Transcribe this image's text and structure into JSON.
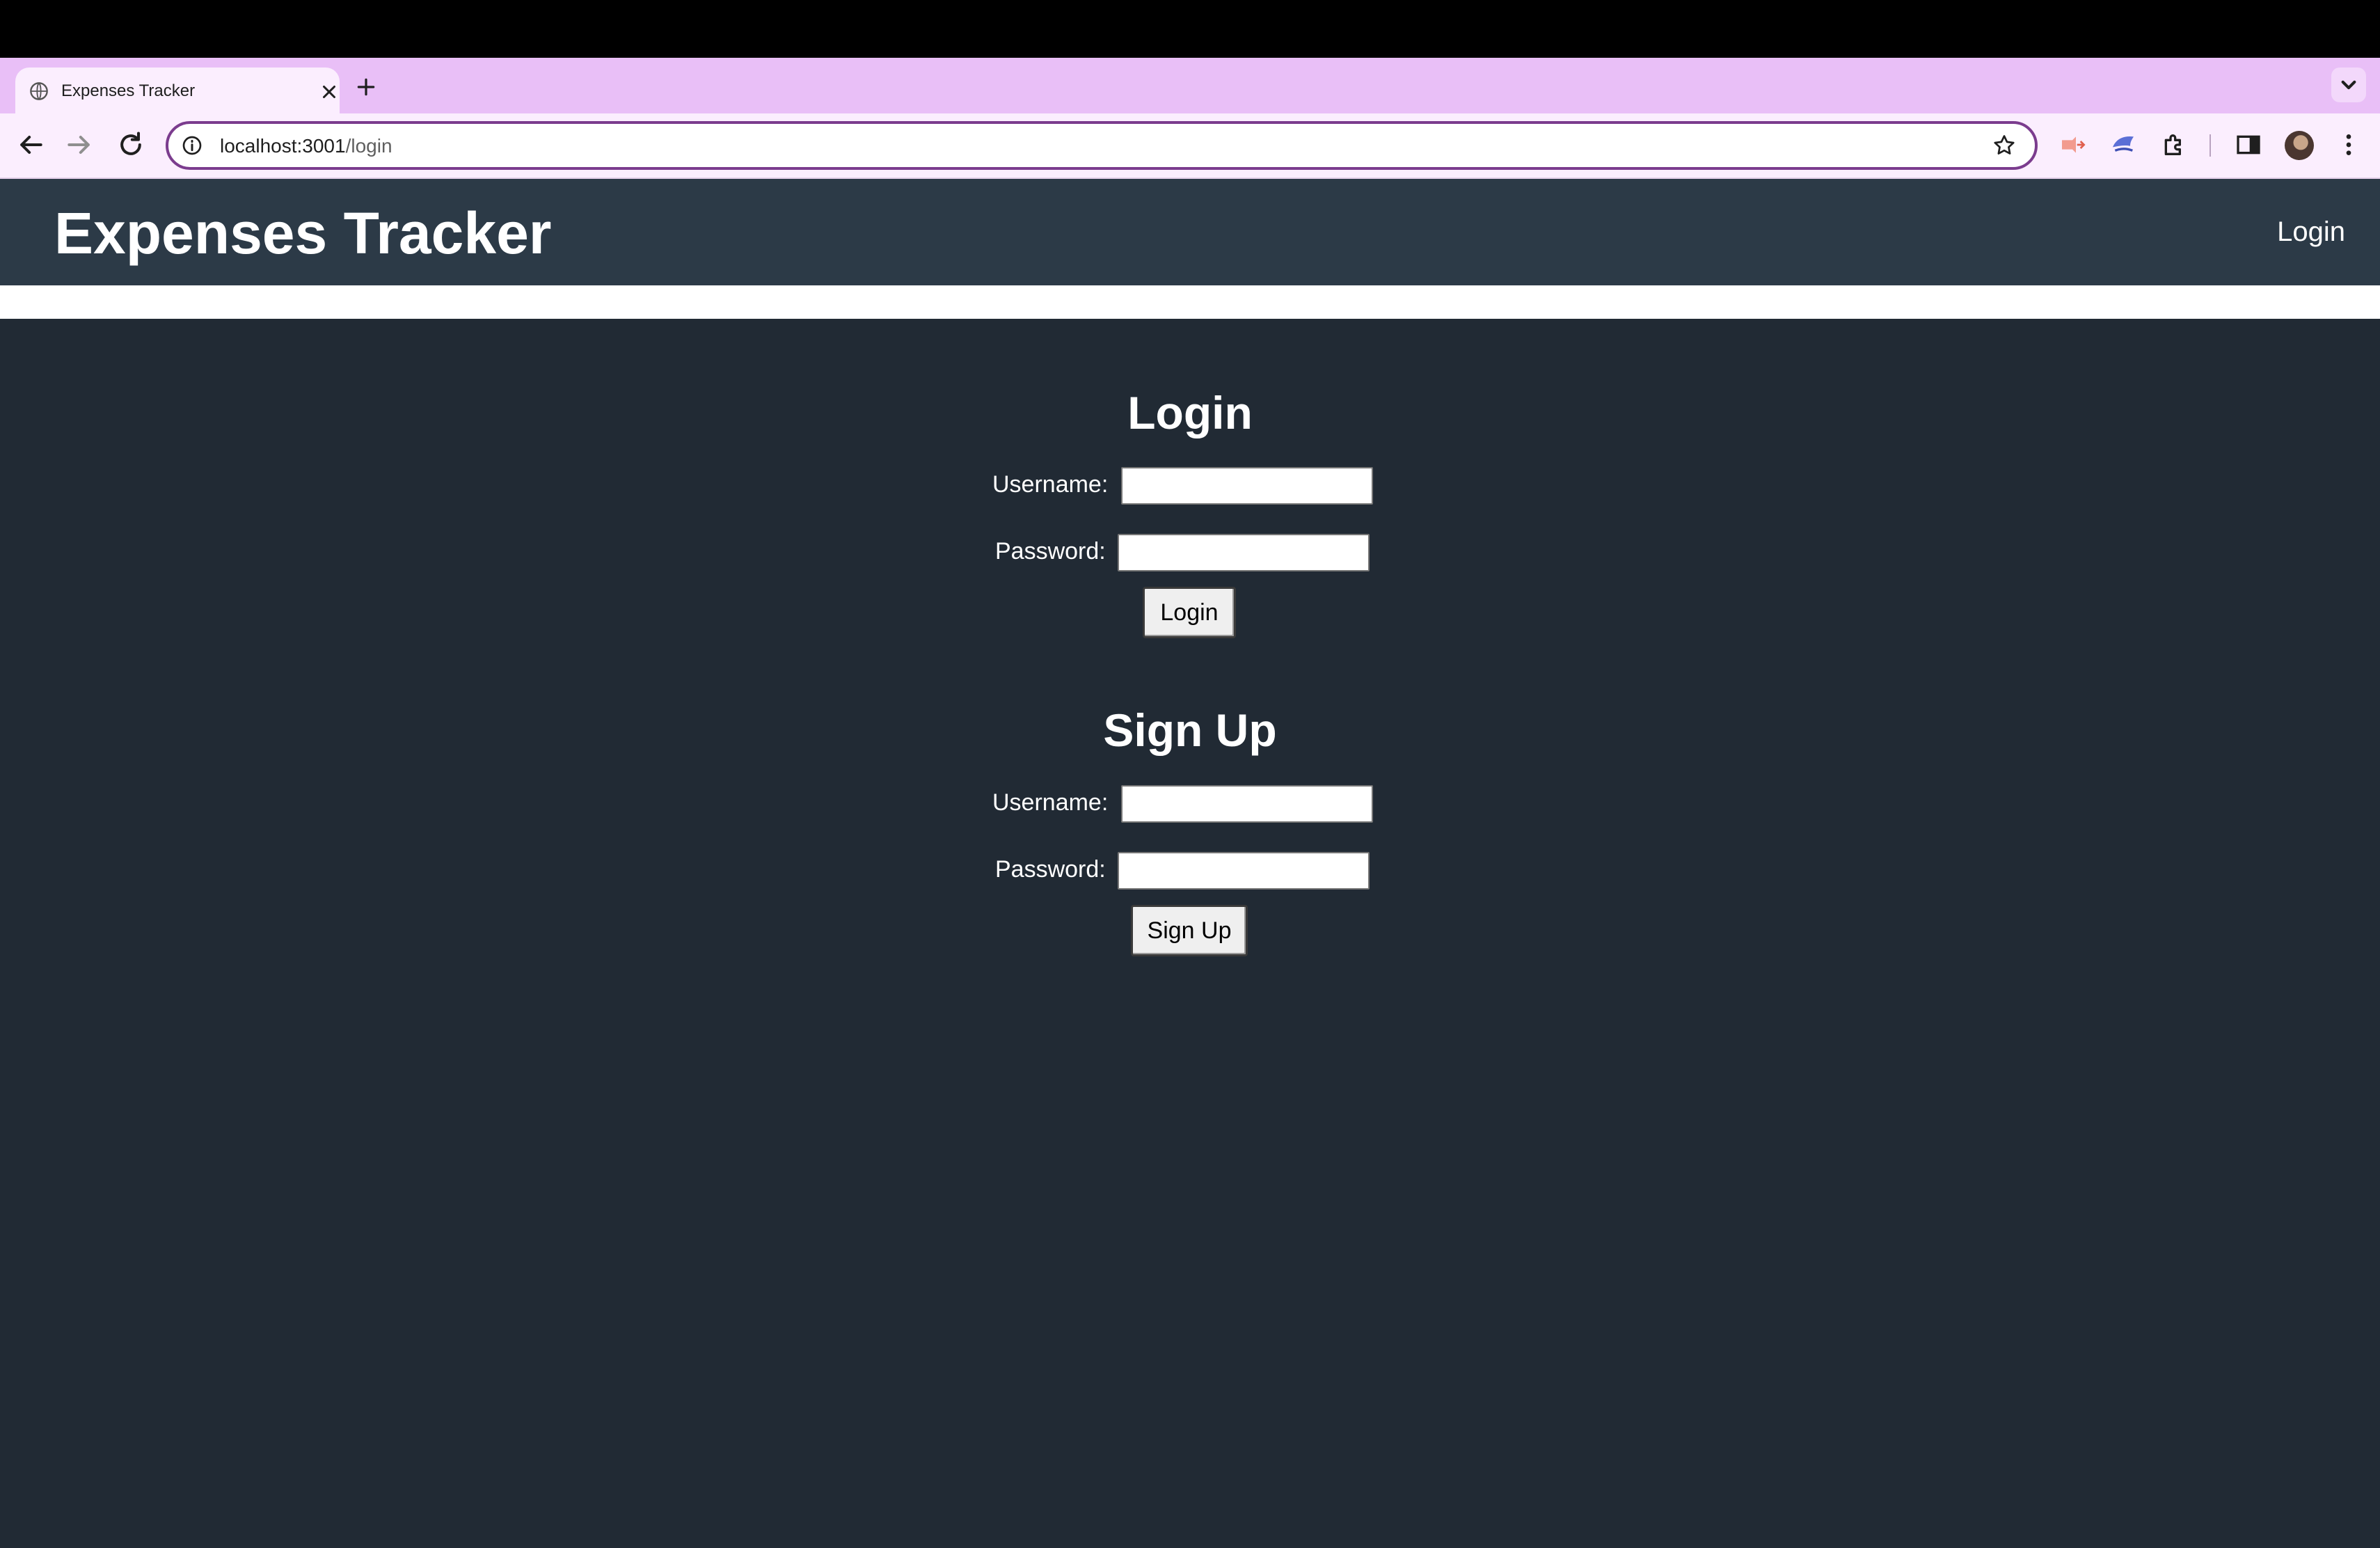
{
  "browser": {
    "tab": {
      "title": "Expenses Tracker"
    },
    "url": {
      "host": "localhost:3001",
      "path": "/login"
    }
  },
  "app": {
    "brand": "Expenses Tracker",
    "nav": {
      "login": "Login"
    }
  },
  "login_form": {
    "title": "Login",
    "username_label": "Username:",
    "username_value": "",
    "password_label": "Password:",
    "password_value": "",
    "submit": "Login"
  },
  "signup_form": {
    "title": "Sign Up",
    "username_label": "Username:",
    "username_value": "",
    "password_label": "Password:",
    "password_value": "",
    "submit": "Sign Up"
  },
  "colors": {
    "tabstrip": "#e9bff7",
    "header": "#2c3a47",
    "page_bg": "#212a34"
  }
}
